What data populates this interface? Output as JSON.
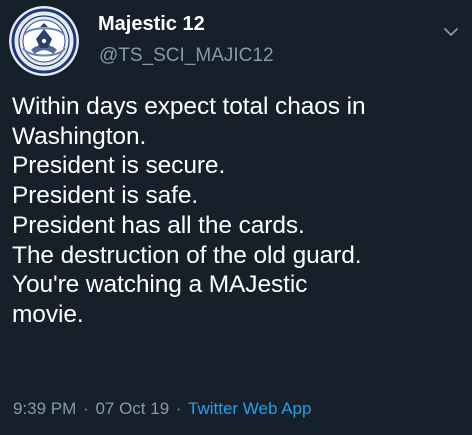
{
  "tweet": {
    "avatar_icon": "agency-seal-icon",
    "display_name": "Majestic 12",
    "handle": "@TS_SCI_MAJIC12",
    "menu_icon": "chevron-down-icon",
    "text_lines": [
      "Within days expect total chaos in",
      "Washington.",
      "President is secure.",
      "President is safe.",
      "President has all the cards.",
      "The destruction of the old guard.",
      "You're watching a MAJestic",
      "movie."
    ],
    "time": "9:39 PM",
    "date": "07 Oct 19",
    "separator": "·",
    "source": "Twitter Web App"
  },
  "colors": {
    "background": "#15202b",
    "primary_text": "#ffffff",
    "secondary_text": "#8899a6",
    "link": "#1da1f2"
  }
}
